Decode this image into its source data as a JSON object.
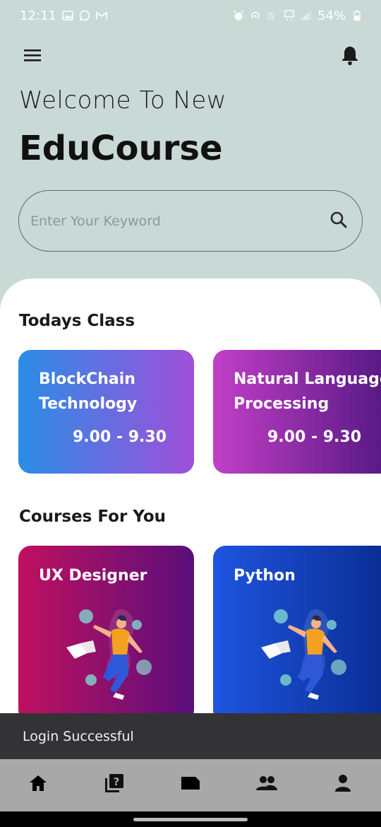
{
  "status_bar": {
    "time": "12:11",
    "battery": "54%"
  },
  "header": {
    "menu_icon": "menu-icon",
    "notification_icon": "bell-icon"
  },
  "welcome": {
    "line1": "Welcome To New",
    "brand": "EduCourse"
  },
  "search": {
    "placeholder": "Enter Your Keyword",
    "icon": "search-icon"
  },
  "todays_class": {
    "title": "Todays Class",
    "items": [
      {
        "title": "BlockChain Technology",
        "time": "9.00 - 9.30",
        "gradient": [
          "#2a8de6",
          "#a04fd9"
        ]
      },
      {
        "title": " Natural Language Processing",
        "time": "9.00 - 9.30",
        "gradient": [
          "#c23fc7",
          "#5a1a85"
        ]
      }
    ]
  },
  "courses": {
    "title": "Courses For You",
    "items": [
      {
        "title": "UX Designer",
        "gradient": [
          "#c01060",
          "#5a0f7a"
        ]
      },
      {
        "title": "Python",
        "gradient": [
          "#1f55e0",
          "#0a2e96"
        ]
      }
    ]
  },
  "snackbar": {
    "message": "Login Successful"
  },
  "bottom_nav": [
    {
      "icon": "home-icon"
    },
    {
      "icon": "quiz-icon"
    },
    {
      "icon": "label-icon"
    },
    {
      "icon": "people-icon"
    },
    {
      "icon": "person-icon"
    }
  ]
}
